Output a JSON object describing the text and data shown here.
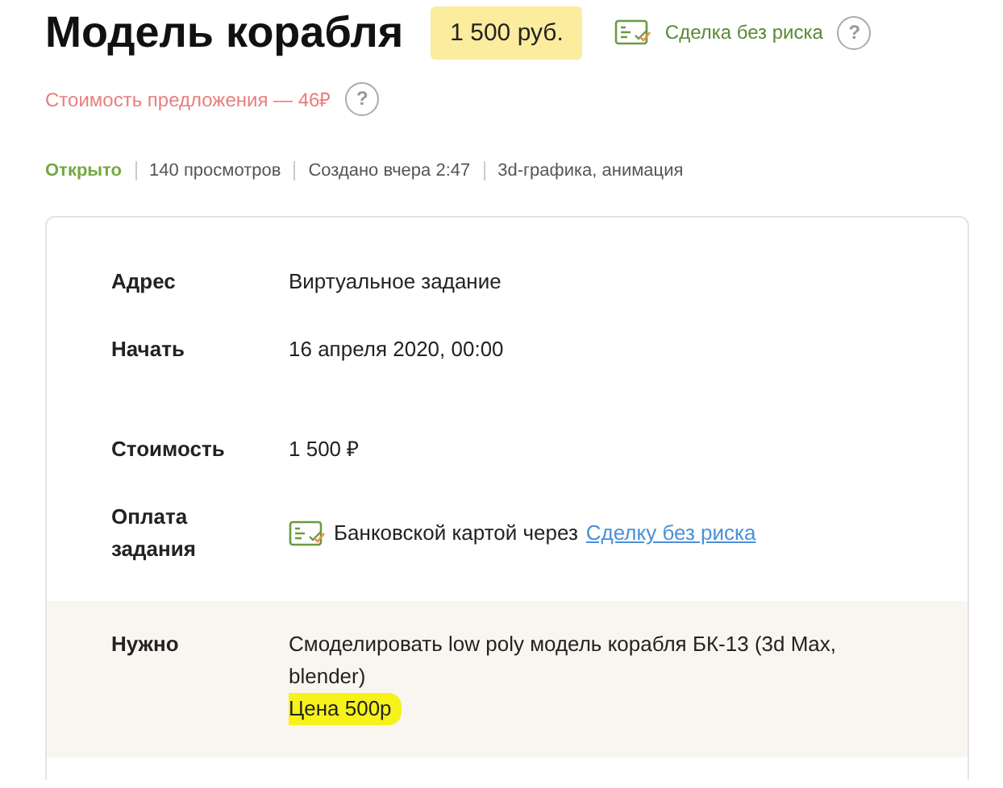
{
  "title": "Модель корабля",
  "price": "1 500 руб.",
  "safe_deal": {
    "label": "Сделка без риска",
    "help": "?"
  },
  "offer_cost": {
    "text": "Стоимость предложения — 46₽",
    "help": "?"
  },
  "meta": [
    {
      "text": "Открыто",
      "kind": "status"
    },
    {
      "text": "140 просмотров",
      "kind": "plain"
    },
    {
      "text": "Создано вчера 2:47",
      "kind": "plain"
    },
    {
      "text": "3d-графика, анимация",
      "kind": "plain"
    }
  ],
  "details": [
    {
      "kind": "text",
      "label": "Адрес",
      "value": "Виртуальное задание"
    },
    {
      "kind": "text",
      "label": "Начать",
      "value": "16 апреля 2020, 00:00",
      "gap_after": true
    },
    {
      "kind": "text",
      "label": "Стоимость",
      "value": "1 500 ₽"
    },
    {
      "kind": "payment",
      "label": "Оплата задания",
      "value": "Банковской картой через",
      "link": "Сделку без риска"
    },
    {
      "kind": "need",
      "label": "Нужно",
      "value": "Смоделировать low poly модель корабля БК-13 (3d Max, blender)",
      "note": "Цена 500р",
      "highlighted": true
    }
  ]
}
